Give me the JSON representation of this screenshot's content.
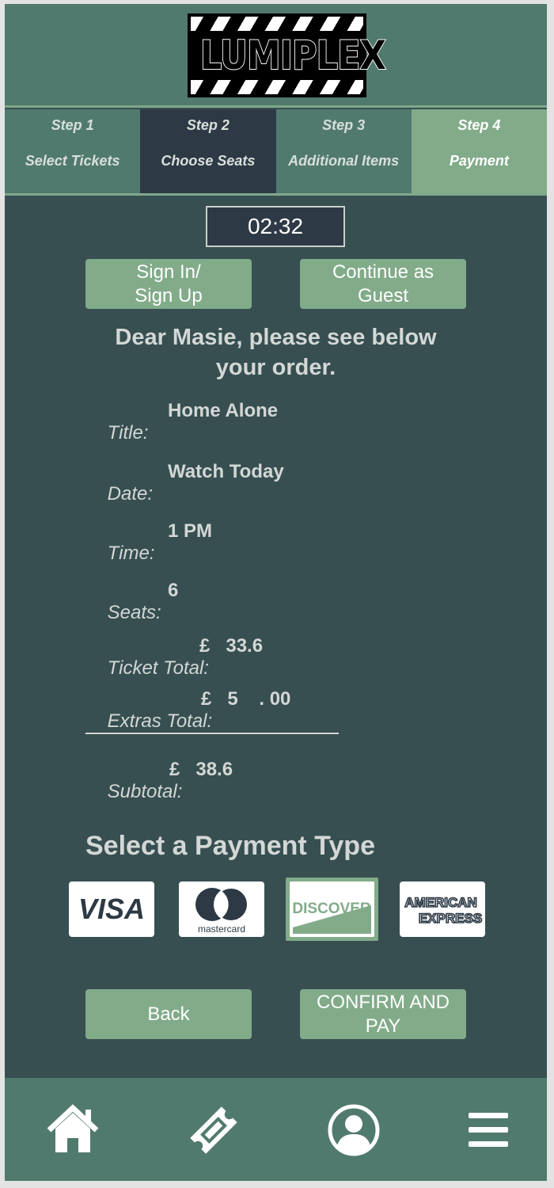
{
  "brand": {
    "logo_text": "LUMIPLEX"
  },
  "steps": [
    {
      "number": "Step 1",
      "name": "Select Tickets"
    },
    {
      "number": "Step 2",
      "name": "Choose Seats"
    },
    {
      "number": "Step 3",
      "name": "Additional Items"
    },
    {
      "number": "Step 4",
      "name": "Payment"
    }
  ],
  "timer": "02:32",
  "auth": {
    "sign_in_label": "Sign In/ Sign Up",
    "guest_label": "Continue as Guest"
  },
  "greeting": "Dear Masie, please see below your order.",
  "order": {
    "title_label": "Title:",
    "title_value": "Home Alone",
    "date_label": "Date:",
    "date_value": "Watch Today",
    "time_label": "Time:",
    "time_value": "1 PM",
    "seats_label": "Seats:",
    "seats_value": "6",
    "ticket_total_label": "Ticket Total:",
    "ticket_total_value": "£   33.6",
    "extras_total_label": "Extras Total:",
    "extras_total_value": "£   5    . 00",
    "subtotal_label": "Subtotal:",
    "subtotal_value": "£   38.6"
  },
  "payment": {
    "title": "Select a Payment Type",
    "cards": [
      {
        "name": "VISA",
        "icon": "visa-logo"
      },
      {
        "name": "mastercard",
        "icon": "mastercard-logo"
      },
      {
        "name": "DISCOVER",
        "icon": "discover-logo",
        "selected": true
      },
      {
        "name_line1": "AMERICAN",
        "name_line2": "EXPRESS",
        "icon": "amex-logo"
      }
    ]
  },
  "actions": {
    "back_label": "Back",
    "confirm_label": "CONFIRM AND PAY"
  },
  "nav": [
    "home-icon",
    "ticket-icon",
    "profile-icon",
    "menu-icon"
  ],
  "colors": {
    "background": "#374f51",
    "header": "#517a6e",
    "accent": "#82ab8a",
    "active_step": "#2d3a45",
    "text": "#d3d7d5"
  }
}
